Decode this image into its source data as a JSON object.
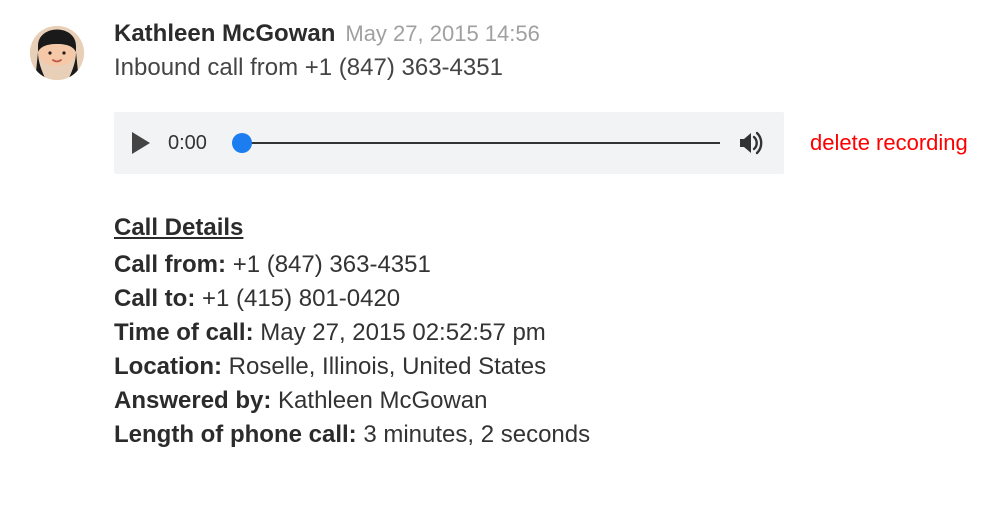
{
  "author": "Kathleen McGowan",
  "timestamp": "May 27, 2015 14:56",
  "summary": "Inbound call from +1 (847) 363-4351",
  "player": {
    "currentTime": "0:00"
  },
  "deleteLabel": "delete recording",
  "detailsTitle": "Call Details",
  "details": {
    "callFromLabel": "Call from:",
    "callFromValue": "+1 (847) 363-4351",
    "callToLabel": "Call to:",
    "callToValue": "+1 (415) 801-0420",
    "timeLabel": "Time of call:",
    "timeValue": "May 27, 2015 02:52:57 pm",
    "locationLabel": "Location:",
    "locationValue": "Roselle, Illinois, United States",
    "answeredLabel": "Answered by:",
    "answeredValue": "Kathleen McGowan",
    "lengthLabel": "Length of phone call:",
    "lengthValue": "3 minutes, 2 seconds"
  }
}
